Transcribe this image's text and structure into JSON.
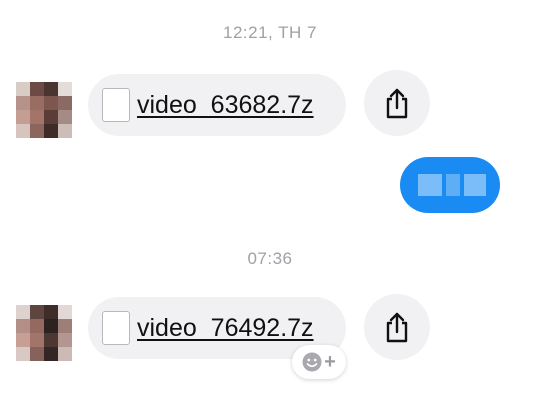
{
  "conversation": {
    "timestamps": [
      "12:21, TH 7",
      "07:36"
    ],
    "messages": [
      {
        "direction": "incoming",
        "type": "file",
        "file_name": "video_63682.7z",
        "file_icon": "document-icon",
        "action_icon": "share-icon"
      },
      {
        "direction": "outgoing",
        "type": "text",
        "content_obscured": true
      },
      {
        "direction": "incoming",
        "type": "file",
        "file_name": "video_76492.7z",
        "file_icon": "document-icon",
        "action_icon": "share-icon"
      }
    ],
    "reaction_button": {
      "icon": "smiley-icon",
      "glyph": "+"
    }
  },
  "colors": {
    "bubble_incoming": "#f1f1f3",
    "bubble_outgoing": "#1a8bf2",
    "timestamp": "#a0a0a6",
    "icon": "#111111"
  }
}
